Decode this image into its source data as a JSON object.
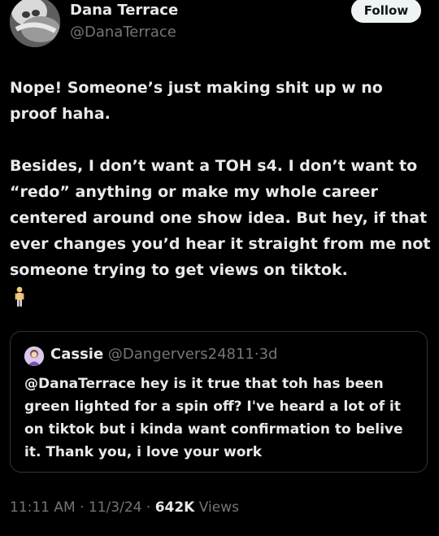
{
  "author": {
    "name": "Dana Terrace",
    "handle": "@DanaTerrace",
    "avatar_icon": "skull-avatar-icon"
  },
  "follow_button": {
    "label": "Follow"
  },
  "tweet": {
    "paragraphs": [
      "Nope! Someone’s just making shit up w no proof haha.",
      "Besides, I don’t want a TOH s4. I don’t want to “redo” anything or make my whole career centered around one show idea. But hey, if that ever changes you’d hear it straight from me not someone trying to get views on tiktok."
    ],
    "trailing_emoji": "person-standing-emoji"
  },
  "quote": {
    "name": "Cassie",
    "handle": "@Dangervers24811",
    "separator": "·",
    "time": "3d",
    "text": "@DanaTerrace hey is it true that toh has been green lighted for a spin off? I've heard a lot of it on tiktok but i kinda want confirmation to belive it. Thank you, i love your work"
  },
  "meta": {
    "time": "11:11 AM",
    "sep1": "·",
    "date": "11/3/24",
    "sep2": "·",
    "views_count": "642K",
    "views_label": "Views"
  },
  "colors": {
    "background": "#000000",
    "text": "#e7e9ea",
    "secondary": "#71767b",
    "border": "#2f3336",
    "follow_bg": "#eff3f4"
  }
}
